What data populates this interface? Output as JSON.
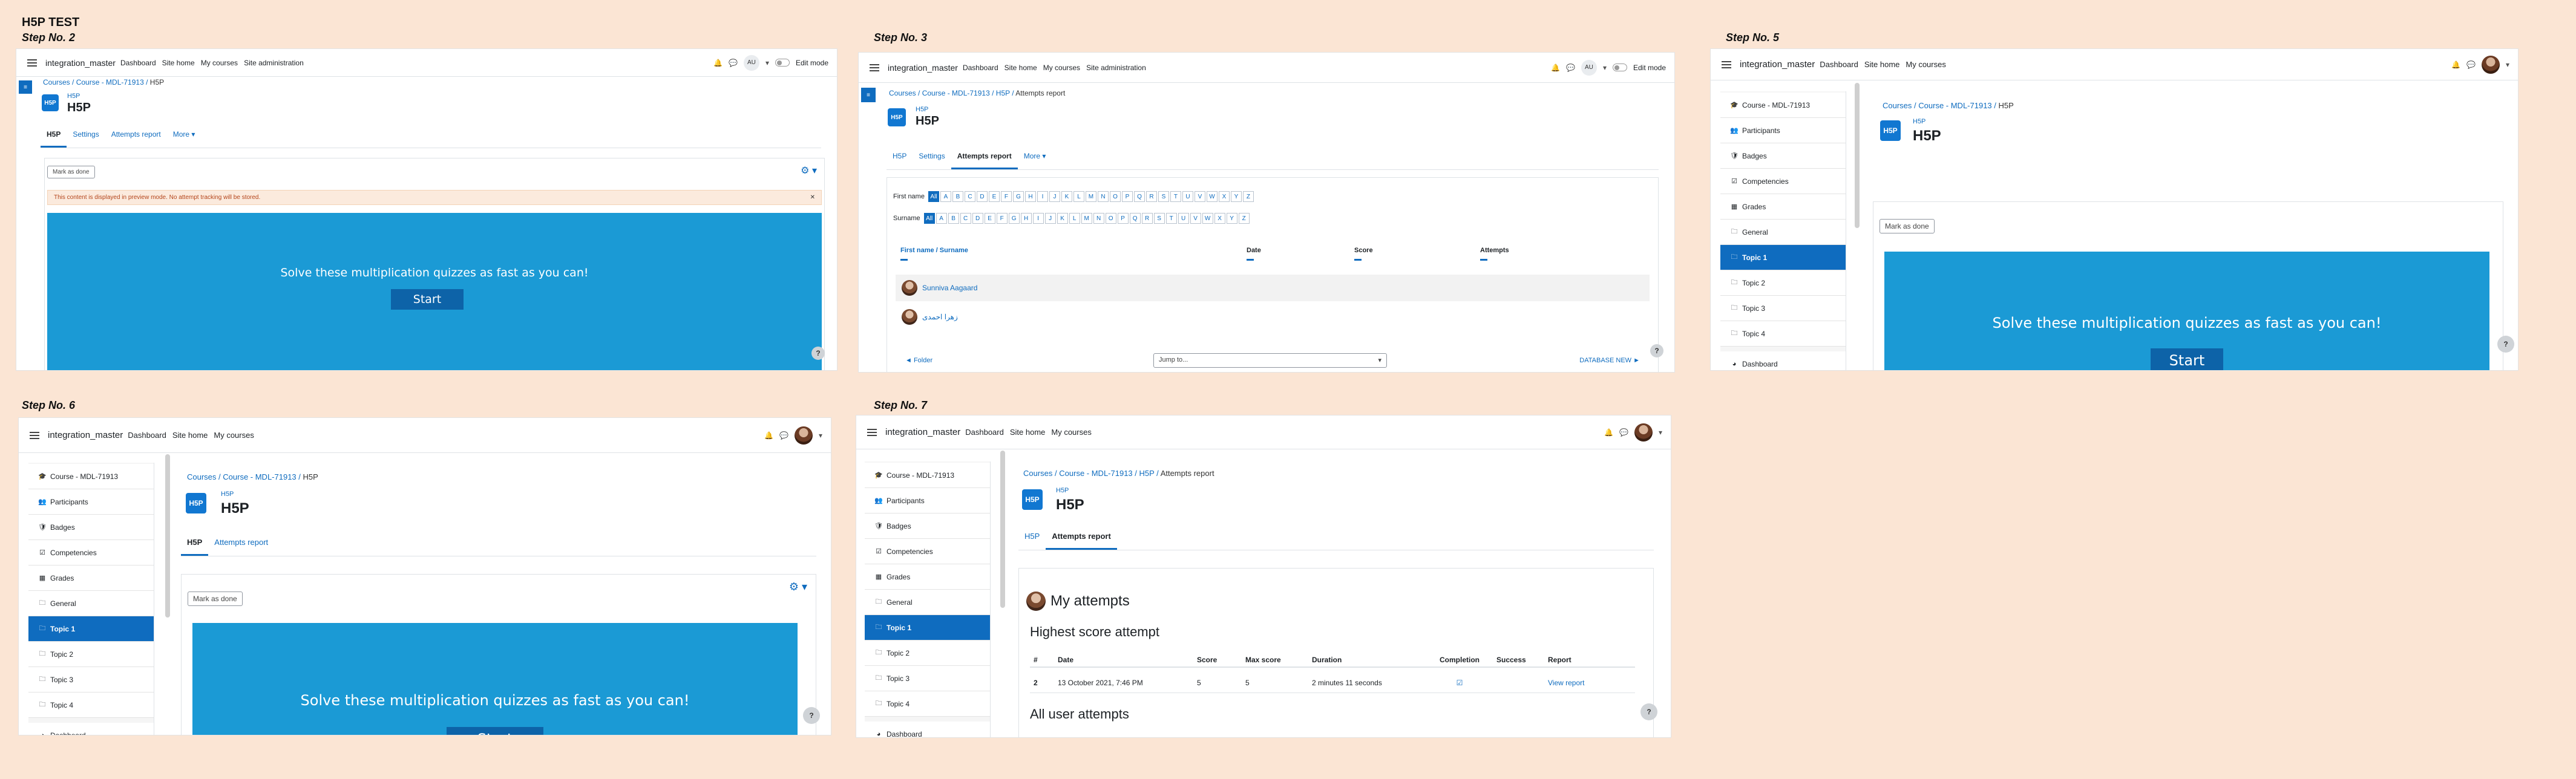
{
  "page_title": "H5P TEST",
  "common": {
    "brand": "integration_master",
    "nav_dashboard": "Dashboard",
    "nav_sitehome": "Site home",
    "nav_mycourses": "My courses",
    "nav_siteadmin": "Site administration",
    "user_initials": "AU",
    "edit_mode": "Edit mode",
    "crumb_courses": "Courses",
    "crumb_course": "Course - MDL-71913",
    "crumb_h5p": "H5P",
    "crumb_attempts": "Attempts report",
    "module_type": "H5P",
    "module_name": "H5P",
    "h5p_icon": "H5P",
    "tab_h5p": "H5P",
    "tab_settings": "Settings",
    "tab_attempts": "Attempts report",
    "tab_more": "More ▾",
    "mark_as_done": "Mark as done",
    "quiz_text": "Solve these multiplication quizzes as fast as you can!",
    "start": "Start",
    "help": "?",
    "gear": "⚙ ▾"
  },
  "sidebar_items": [
    {
      "label": "Course - MDL-71913",
      "icon": "graduation-cap-icon",
      "glyph": "🎓"
    },
    {
      "label": "Participants",
      "icon": "users-icon",
      "glyph": "👥"
    },
    {
      "label": "Badges",
      "icon": "shield-icon",
      "glyph": "🛡"
    },
    {
      "label": "Competencies",
      "icon": "check-square-icon",
      "glyph": "☑"
    },
    {
      "label": "Grades",
      "icon": "table-icon",
      "glyph": "▦"
    },
    {
      "label": "General",
      "icon": "folder-icon",
      "glyph": "🗀"
    },
    {
      "label": "Topic 1",
      "icon": "folder-icon",
      "glyph": "🗀"
    },
    {
      "label": "Topic 2",
      "icon": "folder-icon",
      "glyph": "🗀"
    },
    {
      "label": "Topic 3",
      "icon": "folder-icon",
      "glyph": "🗀"
    },
    {
      "label": "Topic 4",
      "icon": "folder-icon",
      "glyph": "🗀"
    },
    {
      "label": "Dashboard",
      "icon": "dashboard-icon",
      "glyph": "◕"
    }
  ],
  "step2": {
    "label": "Step No. 2",
    "warning": "This content is displayed in preview mode. No attempt tracking will be stored.",
    "close": "✕"
  },
  "step3": {
    "label": "Step No. 3",
    "firstname_label": "First name",
    "surname_label": "Surname",
    "all": "All",
    "letters": [
      "A",
      "B",
      "C",
      "D",
      "E",
      "F",
      "G",
      "H",
      "I",
      "J",
      "K",
      "L",
      "M",
      "N",
      "O",
      "P",
      "Q",
      "R",
      "S",
      "T",
      "U",
      "V",
      "W",
      "X",
      "Y",
      "Z"
    ],
    "col_name": "First name / Surname",
    "col_date": "Date",
    "col_score": "Score",
    "col_attempts": "Attempts",
    "user1": "Sunniva Aagaard",
    "user2": "زهرا احمدی",
    "prev": "◄ Folder",
    "jump": "Jump to...",
    "next": "DATABASE NEW ►"
  },
  "step5": {
    "label": "Step No. 5"
  },
  "step6": {
    "label": "Step No. 6"
  },
  "step7": {
    "label": "Step No. 7",
    "my_attempts": "My attempts",
    "highest": "Highest score attempt",
    "cols": [
      "#",
      "Date",
      "Score",
      "Max score",
      "Duration",
      "Completion",
      "Success",
      "Report"
    ],
    "row": {
      "num": "2",
      "date": "13 October 2021, 7:46 PM",
      "score": "5",
      "max": "5",
      "duration": "2 minutes 11 seconds",
      "completion": "☑",
      "success": "",
      "report": "View report"
    },
    "all_user": "All user attempts"
  }
}
